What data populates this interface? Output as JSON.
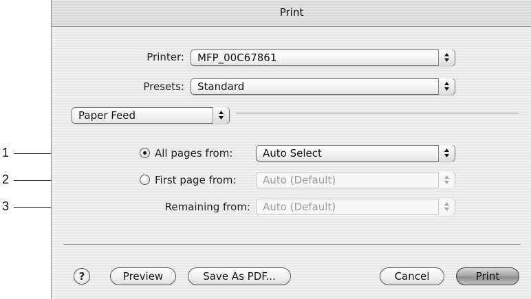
{
  "callouts": [
    "1",
    "2",
    "3"
  ],
  "dialog": {
    "title": "Print",
    "printer": {
      "label": "Printer:",
      "value": "MFP_00C67861"
    },
    "presets": {
      "label": "Presets:",
      "value": "Standard"
    },
    "pane": {
      "value": "Paper Feed"
    },
    "all_pages": {
      "label": "All pages from:",
      "value": "Auto Select",
      "selected": true
    },
    "first_page": {
      "label": "First page from:",
      "value": "Auto (Default)",
      "selected": false,
      "enabled": false
    },
    "remaining": {
      "label": "Remaining from:",
      "value": "Auto (Default)",
      "enabled": false
    }
  },
  "buttons": {
    "help": "?",
    "preview": "Preview",
    "save_pdf": "Save As PDF...",
    "cancel": "Cancel",
    "print": "Print"
  }
}
